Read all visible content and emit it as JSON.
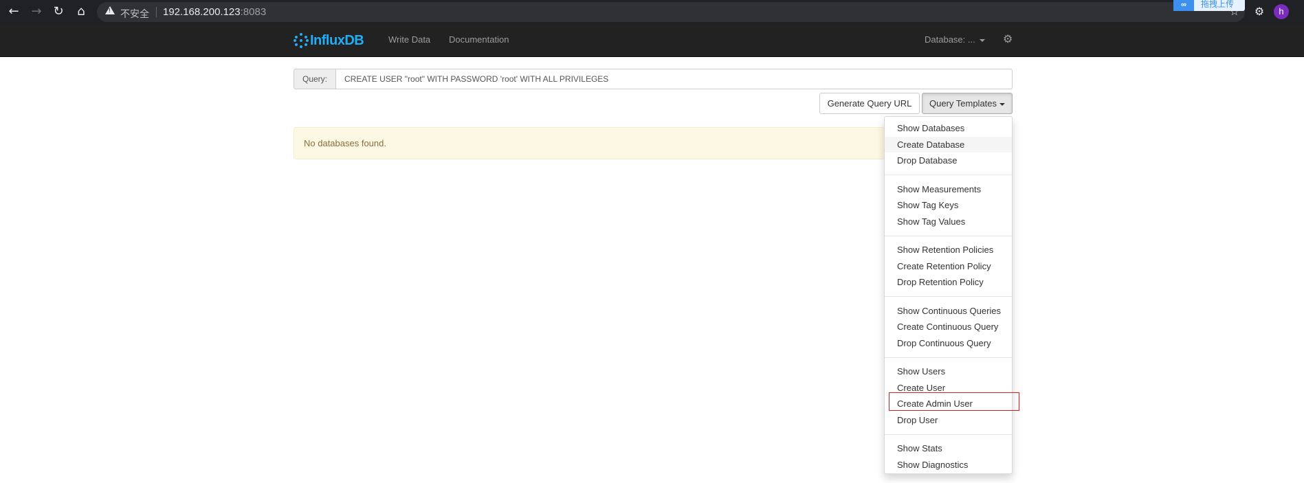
{
  "browser": {
    "insecure_label": "不安全",
    "url_host": "192.168.200.123",
    "url_port": ":8083",
    "extension_badge": "拖拽上传",
    "extension_logo": "∞",
    "avatar_letter": "h"
  },
  "navbar": {
    "brand": "InfluxDB",
    "write_data": "Write Data",
    "documentation": "Documentation",
    "database_label": "Database: ...",
    "brand_color": "#22adf6"
  },
  "query": {
    "label": "Query:",
    "value": "CREATE USER \"root\" WITH PASSWORD 'root' WITH ALL PRIVILEGES"
  },
  "buttons": {
    "generate_url": "Generate Query URL",
    "templates": "Query Templates"
  },
  "alert": {
    "message": "No databases found."
  },
  "templates_menu": {
    "groups": [
      [
        "Show Databases",
        "Create Database",
        "Drop Database"
      ],
      [
        "Show Measurements",
        "Show Tag Keys",
        "Show Tag Values"
      ],
      [
        "Show Retention Policies",
        "Create Retention Policy",
        "Drop Retention Policy"
      ],
      [
        "Show Continuous Queries",
        "Create Continuous Query",
        "Drop Continuous Query"
      ],
      [
        "Show Users",
        "Create User",
        "Create Admin User",
        "Drop User"
      ],
      [
        "Show Stats",
        "Show Diagnostics"
      ]
    ],
    "hovered_item": "Create Database",
    "highlighted_item": "Create Admin User",
    "highlight_color": "#e01818"
  }
}
